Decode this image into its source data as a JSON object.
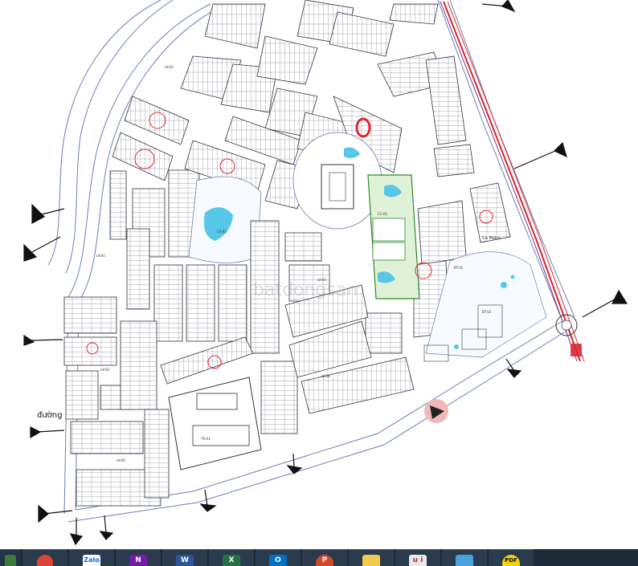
{
  "window": {
    "title": ""
  },
  "drawing": {
    "road_label": "đường",
    "watermark": "batdongsan",
    "roundabout_label": "Ga Metro",
    "block_labels": [
      "LK-01",
      "LK-02",
      "LK-03",
      "LK-04",
      "LK-05",
      "LK-06",
      "BT-01",
      "BT-02",
      "TH-01",
      "CC-01",
      "CX-01"
    ],
    "colors": {
      "background": "#ffffff",
      "road_line": "#6b7fb0",
      "block_line": "#333344",
      "lot_line": "#6a6a88",
      "park_fill": "#dff2d8",
      "park_line": "#2c8a2c",
      "water": "#57c7e8",
      "rail_red": "#d8232a",
      "rail_purple": "#7a2a8a",
      "marker_red": "#e0282e",
      "arrow": "#111111",
      "pink_marker": "#f1b8b8"
    }
  },
  "taskbar": {
    "items": [
      {
        "name": "start-edge",
        "icon": "windows-edge-icon",
        "label": ""
      },
      {
        "name": "chrome",
        "icon": "chrome-icon",
        "label": ""
      },
      {
        "name": "zalo",
        "icon": "zalo-icon",
        "label": "Zalo"
      },
      {
        "name": "onenote",
        "icon": "onenote-icon",
        "label": "N"
      },
      {
        "name": "word",
        "icon": "word-icon",
        "label": "W"
      },
      {
        "name": "excel",
        "icon": "excel-icon",
        "label": "X"
      },
      {
        "name": "outlook",
        "icon": "outlook-icon",
        "label": "O"
      },
      {
        "name": "powerpoint",
        "icon": "powerpoint-icon",
        "label": "P"
      },
      {
        "name": "file-explorer",
        "icon": "folder-icon",
        "label": ""
      },
      {
        "name": "app-ui",
        "icon": "app-icon",
        "label": "u i"
      },
      {
        "name": "photos",
        "icon": "photos-icon",
        "label": ""
      },
      {
        "name": "pdf",
        "icon": "pdf-icon",
        "label": "PDF"
      }
    ]
  }
}
